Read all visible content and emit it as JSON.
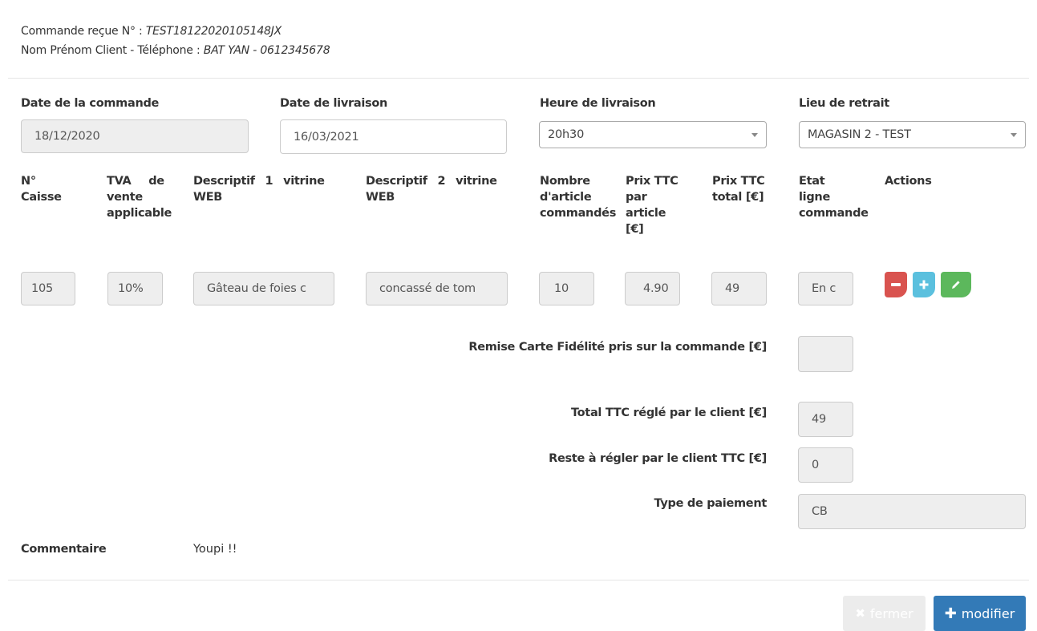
{
  "header": {
    "order_label": "Commande reçue N° : ",
    "order_value": "TEST18122020105148JX",
    "client_label": "Nom Prénom Client - Téléphone : ",
    "client_value": "BAT YAN - 0612345678"
  },
  "form": {
    "order_date_label": "Date de la commande",
    "order_date_value": "18/12/2020",
    "delivery_date_label": "Date de livraison",
    "delivery_date_value": "16/03/2021",
    "delivery_time_label": "Heure de livraison",
    "delivery_time_value": "20h30",
    "pickup_label": "Lieu de retrait",
    "pickup_value": "MAGASIN 2 - TEST"
  },
  "table": {
    "headers": {
      "caisse": [
        "N°",
        "Caisse"
      ],
      "tva": [
        "TVA de",
        "vente",
        "applicable"
      ],
      "desc1": [
        "Descriptif 1 vitrine",
        "WEB"
      ],
      "desc2": [
        "Descriptif 2 vitrine",
        "WEB"
      ],
      "nombre": [
        "Nombre",
        "d'article",
        "commandés"
      ],
      "prix_unit": [
        "Prix TTC",
        "par",
        "article",
        "[€]"
      ],
      "prix_total": [
        "Prix TTC",
        "total [€]"
      ],
      "etat": [
        "Etat",
        "ligne",
        "commande"
      ],
      "actions": "Actions"
    },
    "row": {
      "caisse": "105",
      "tva": "10%",
      "desc1": "Gâteau de foies c",
      "desc2": "concassé de tom",
      "nombre": "10",
      "prix_unit": "4.90",
      "prix_total": "49",
      "etat": "En c"
    },
    "action_icons": [
      "minus-icon",
      "plus-icon",
      "pencil-icon"
    ],
    "action_colors": [
      "#d9534f",
      "#5bc0de",
      "#5cb85c"
    ]
  },
  "summary": {
    "remise_label": "Remise Carte Fidélité pris sur la commande [€]",
    "remise_value": "",
    "total_label": "Total TTC réglé par le client [€]",
    "total_value": "49",
    "reste_label": "Reste à régler par le client TTC [€]",
    "reste_value": "0",
    "paiement_label": "Type de paiement",
    "paiement_value": "CB"
  },
  "comment": {
    "label": "Commentaire",
    "value": "Youpi !!"
  },
  "footer": {
    "close_label": "fermer",
    "modify_label": "modifier",
    "close_icon": "x-icon",
    "modify_icon": "plus-icon"
  }
}
